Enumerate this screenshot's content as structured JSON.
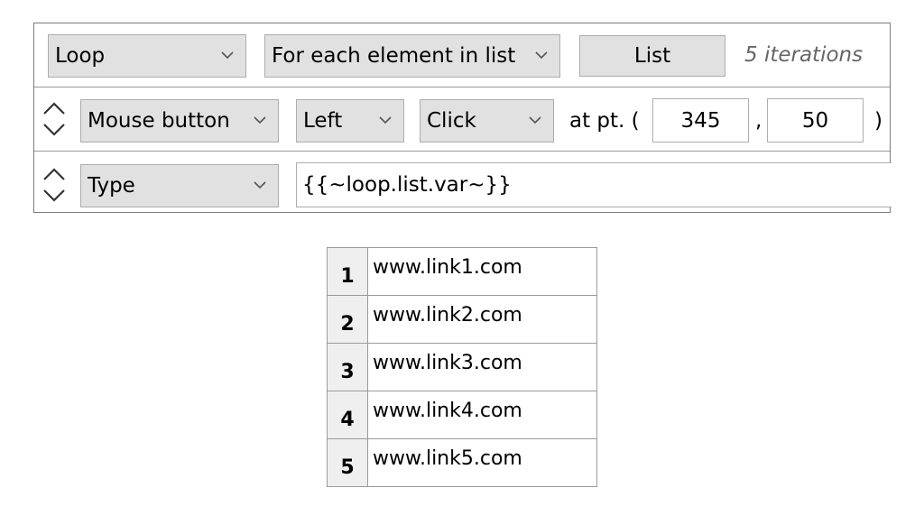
{
  "loop_row": {
    "action": "Loop",
    "mode": "For each element in list",
    "list_button": "List",
    "iterations": "5 iterations"
  },
  "mouse_row": {
    "action": "Mouse button",
    "button": "Left",
    "event": "Click",
    "at_pt_label": "at pt. (",
    "x": "345",
    "comma": ",",
    "y": "50",
    "close_paren": ")"
  },
  "type_row": {
    "action": "Type",
    "text": "{{~loop.list.var~}}"
  },
  "list_table": {
    "rows": [
      {
        "index": "1",
        "value": "www.link1.com"
      },
      {
        "index": "2",
        "value": "www.link2.com"
      },
      {
        "index": "3",
        "value": "www.link3.com"
      },
      {
        "index": "4",
        "value": "www.link4.com"
      },
      {
        "index": "5",
        "value": "www.link5.com"
      }
    ]
  },
  "icons": {
    "dropdown": "chevron-down-icon",
    "reorder": "up-down-arrows-icon"
  }
}
